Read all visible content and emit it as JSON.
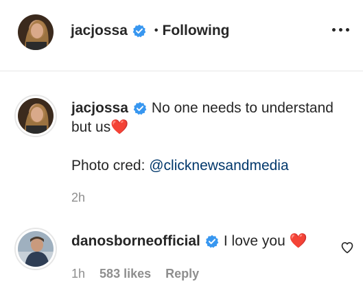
{
  "header": {
    "username": "jacjossa",
    "separator": "•",
    "follow_status": "Following"
  },
  "caption": {
    "username": "jacjossa",
    "text_line1": "No one needs to understand",
    "text_line2": "but us",
    "heart": "❤️",
    "photo_cred_label": "Photo cred: ",
    "photo_cred_handle": "@clicknewsandmedia",
    "time": "2h"
  },
  "comment": {
    "username": "danosborneofficial",
    "text": "I love you",
    "heart": "❤️",
    "time": "1h",
    "likes": "583 likes",
    "reply": "Reply"
  },
  "colors": {
    "verified_badge": "#3897f0",
    "heart": "#e0245e",
    "link": "#00376b",
    "muted": "#8e8e8e"
  },
  "icons": [
    "verified-badge-icon",
    "more-options-icon",
    "heart-outline-icon"
  ]
}
